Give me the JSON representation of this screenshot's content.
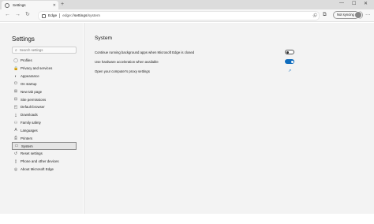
{
  "browser": {
    "tab_title": "Settings",
    "tab_close": "✕",
    "new_tab": "+",
    "window_controls": [
      "—",
      "☐",
      "✕"
    ],
    "address": {
      "site": "Edge",
      "url_prefix": "edge://",
      "url_main": "settings",
      "url_suffix": "/system"
    },
    "sync_label": "Not syncing",
    "menu_label": "···"
  },
  "sidebar": {
    "title": "Settings",
    "search_placeholder": "Search settings",
    "items": [
      {
        "label": "Profiles",
        "icon": "profile-icon",
        "glyph": "◯"
      },
      {
        "label": "Privacy and services",
        "icon": "lock-icon",
        "glyph": "🔒"
      },
      {
        "label": "Appearance",
        "icon": "appearance-icon",
        "glyph": "◐"
      },
      {
        "label": "On startup",
        "icon": "power-icon",
        "glyph": "⏻"
      },
      {
        "label": "New tab page",
        "icon": "new-tab-icon",
        "glyph": "⊞"
      },
      {
        "label": "Site permissions",
        "icon": "site-permissions-icon",
        "glyph": "⊟"
      },
      {
        "label": "Default browser",
        "icon": "default-browser-icon",
        "glyph": "◰"
      },
      {
        "label": "Downloads",
        "icon": "download-icon",
        "glyph": "⤓"
      },
      {
        "label": "Family safety",
        "icon": "family-icon",
        "glyph": "⚇"
      },
      {
        "label": "Languages",
        "icon": "languages-icon",
        "glyph": "A"
      },
      {
        "label": "Printers",
        "icon": "printer-icon",
        "glyph": "⎙"
      },
      {
        "label": "System",
        "icon": "system-icon",
        "glyph": "▭"
      },
      {
        "label": "Reset settings",
        "icon": "reset-icon",
        "glyph": "↺"
      },
      {
        "label": "Phone and other devices",
        "icon": "phone-icon",
        "glyph": "▯"
      },
      {
        "label": "About Microsoft Edge",
        "icon": "edge-icon",
        "glyph": "◎"
      }
    ],
    "active_index": 11
  },
  "main": {
    "title": "System",
    "settings": [
      {
        "label": "Continue running background apps when Microsoft Edge is closed",
        "state": "off"
      },
      {
        "label": "Use hardware acceleration when available",
        "state": "on"
      },
      {
        "label": "Open your computer's proxy settings",
        "state": "link"
      }
    ]
  },
  "colors": {
    "accent": "#0f6cbd",
    "background": "#f3f3f3"
  }
}
